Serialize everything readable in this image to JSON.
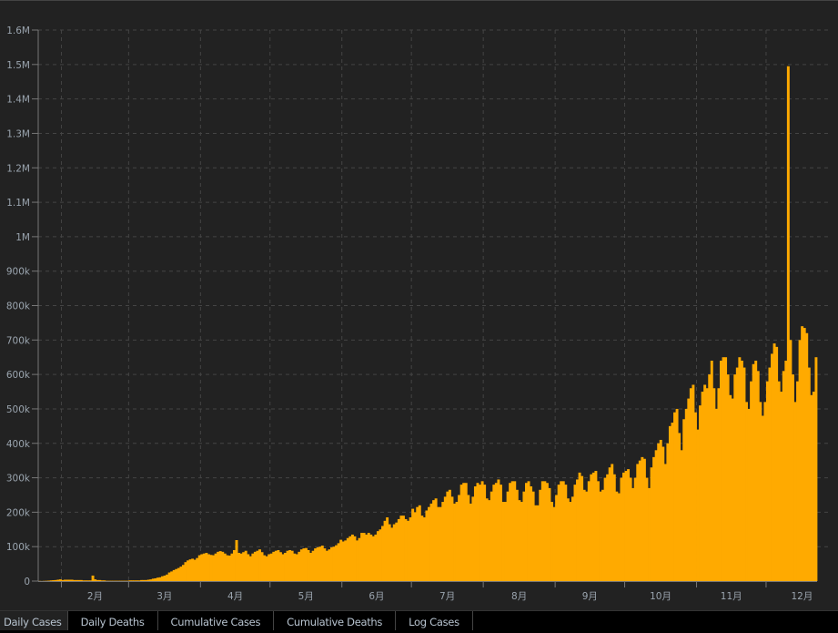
{
  "colors": {
    "bar": "#ffaa00",
    "background": "#222222",
    "grid": "#444444",
    "axis": "#777777",
    "text": "#9aa4ae"
  },
  "tabs": [
    {
      "label": "Daily Cases",
      "active": true
    },
    {
      "label": "Daily Deaths",
      "active": false
    },
    {
      "label": "Cumulative Cases",
      "active": false
    },
    {
      "label": "Cumulative Deaths",
      "active": false
    },
    {
      "label": "Log Cases",
      "active": false
    }
  ],
  "chart_data": {
    "type": "bar",
    "title": "",
    "xlabel": "",
    "ylabel": "",
    "start_date": "01-22",
    "ylim": [
      0,
      1600000
    ],
    "yticks": [
      0,
      100000,
      200000,
      300000,
      400000,
      500000,
      600000,
      700000,
      800000,
      900000,
      1000000,
      1100000,
      1200000,
      1300000,
      1400000,
      1500000,
      1600000
    ],
    "ytick_labels": [
      "0",
      "100k",
      "200k",
      "300k",
      "400k",
      "500k",
      "600k",
      "700k",
      "800k",
      "900k",
      "1M",
      "1.1M",
      "1.2M",
      "1.3M",
      "1.4M",
      "1.5M",
      "1.6M"
    ],
    "month_labels": [
      "2月",
      "3月",
      "4月",
      "5月",
      "6月",
      "7月",
      "8月",
      "9月",
      "10月",
      "11月",
      "12月"
    ],
    "month_start_day_index": [
      10,
      39,
      70,
      100,
      131,
      161,
      192,
      223,
      253,
      284,
      314
    ],
    "grid": true,
    "unit": "thousands",
    "values_k": [
      0.5,
      0.3,
      0.6,
      0.9,
      1.3,
      2,
      2.5,
      3,
      4,
      5,
      3,
      4,
      4,
      4,
      4,
      3,
      3,
      3,
      3,
      2,
      2,
      2,
      2,
      16,
      5,
      3,
      3,
      2,
      2,
      1,
      1,
      1,
      1,
      1,
      1,
      1,
      1,
      1,
      1,
      2,
      2,
      2,
      2,
      2,
      3,
      3,
      3,
      4,
      5,
      7,
      8,
      10,
      11,
      14,
      16,
      19,
      25,
      28,
      32,
      35,
      38,
      42,
      47,
      55,
      60,
      63,
      65,
      62,
      67,
      75,
      78,
      80,
      82,
      78,
      76,
      75,
      80,
      85,
      87,
      85,
      80,
      75,
      74,
      80,
      90,
      119,
      82,
      80,
      84,
      88,
      78,
      72,
      80,
      85,
      88,
      92,
      84,
      75,
      72,
      78,
      80,
      85,
      88,
      90,
      84,
      78,
      82,
      88,
      90,
      88,
      80,
      78,
      85,
      92,
      95,
      96,
      90,
      82,
      88,
      95,
      98,
      100,
      103,
      95,
      88,
      92,
      98,
      100,
      104,
      110,
      120,
      115,
      118,
      125,
      130,
      135,
      130,
      118,
      125,
      140,
      140,
      135,
      140,
      135,
      130,
      135,
      145,
      150,
      160,
      175,
      185,
      165,
      155,
      165,
      170,
      180,
      190,
      190,
      180,
      175,
      185,
      210,
      200,
      215,
      220,
      190,
      185,
      205,
      215,
      225,
      235,
      240,
      215,
      215,
      230,
      245,
      260,
      265,
      245,
      225,
      230,
      250,
      280,
      285,
      285,
      250,
      225,
      245,
      275,
      285,
      280,
      290,
      280,
      240,
      235,
      260,
      280,
      285,
      295,
      280,
      230,
      230,
      260,
      285,
      290,
      290,
      265,
      235,
      230,
      260,
      285,
      290,
      275,
      260,
      220,
      220,
      265,
      290,
      290,
      285,
      270,
      230,
      215,
      250,
      280,
      290,
      290,
      280,
      240,
      230,
      245,
      280,
      295,
      315,
      305,
      265,
      260,
      290,
      310,
      315,
      320,
      290,
      260,
      265,
      300,
      310,
      330,
      340,
      310,
      260,
      255,
      300,
      315,
      320,
      325,
      300,
      270,
      300,
      340,
      350,
      360,
      355,
      300,
      270,
      330,
      360,
      380,
      400,
      410,
      390,
      340,
      400,
      450,
      460,
      490,
      500,
      430,
      380,
      470,
      500,
      530,
      560,
      570,
      490,
      440,
      510,
      550,
      570,
      560,
      600,
      640,
      560,
      500,
      560,
      640,
      650,
      650,
      600,
      540,
      530,
      600,
      620,
      650,
      640,
      620,
      520,
      500,
      580,
      630,
      640,
      610,
      520,
      480,
      520,
      580,
      620,
      660,
      690,
      680,
      580,
      550,
      610,
      640,
      1495,
      700,
      600,
      520,
      580,
      700,
      740,
      735,
      720,
      620,
      540,
      550,
      650
    ]
  }
}
